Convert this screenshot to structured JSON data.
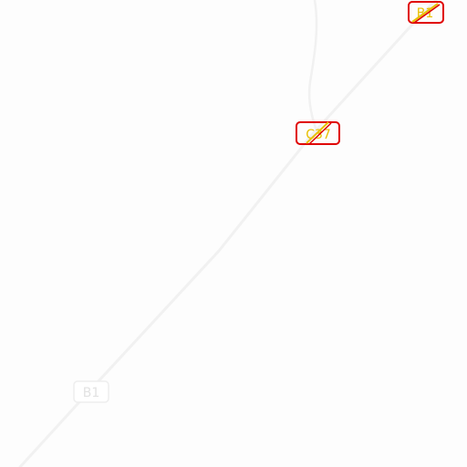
{
  "map": {
    "background_color": "#fdfdfd",
    "road_color": "#f1f1f1",
    "road_labels": [
      {
        "id": "b1-upper",
        "text": "B1",
        "state": "highlighted",
        "icon": "road-shield-icon"
      },
      {
        "id": "c37",
        "text": "C37",
        "state": "highlighted",
        "icon": "road-shield-icon"
      },
      {
        "id": "b1-lower",
        "text": "B1",
        "state": "normal",
        "icon": "road-shield-icon"
      }
    ],
    "highlight": {
      "box_color": "#e00000",
      "strike_color": "#e8c000",
      "text_color": "#e8c000"
    },
    "normal_shield": {
      "border_color": "#eeeeee",
      "text_color": "#e2e2e2",
      "fill_color": "#ffffff"
    }
  }
}
